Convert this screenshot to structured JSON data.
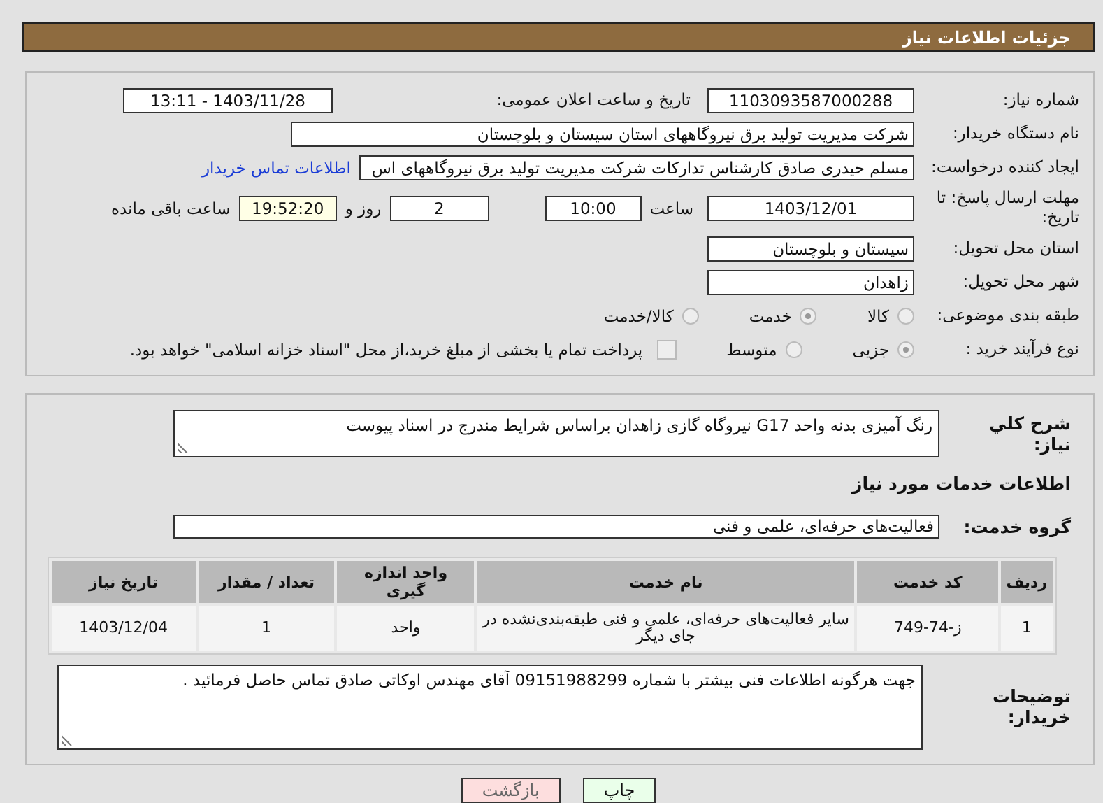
{
  "title": "جزئیات اطلاعات نیاز",
  "need_number": {
    "label": "شماره نیاز:",
    "value": "1103093587000288"
  },
  "announce": {
    "label": "تاریخ و ساعت اعلان عمومی:",
    "value": "1403/11/28 - 13:11"
  },
  "buyer": {
    "label": "نام دستگاه خریدار:",
    "value": "شرکت مدیریت تولید برق نیروگاههای استان سیستان و بلوچستان"
  },
  "requester": {
    "label": "ایجاد کننده درخواست:",
    "value": "مسلم حیدری صادق کارشناس تدارکات شرکت مدیریت تولید برق نیروگاههای اس",
    "link": "اطلاعات تماس خریدار"
  },
  "deadline": {
    "label": "مهلت ارسال پاسخ: تا تاریخ:",
    "date": "1403/12/01",
    "time_label": "ساعت",
    "time": "10:00",
    "days": "2",
    "days_label": "روز و",
    "remaining": "19:52:20",
    "remaining_label": "ساعت باقی مانده"
  },
  "province": {
    "label": "استان محل تحویل:",
    "value": "سیستان و بلوچستان"
  },
  "city": {
    "label": "شهر محل تحویل:",
    "value": "زاهدان"
  },
  "category": {
    "label": "طبقه بندی موضوعی:",
    "options": [
      {
        "label": "کالا",
        "selected": false
      },
      {
        "label": "خدمت",
        "selected": true
      },
      {
        "label": "کالا/خدمت",
        "selected": false
      }
    ]
  },
  "purchase_type": {
    "label": "نوع فرآیند خرید :",
    "options": [
      {
        "label": "جزیی",
        "selected": true
      },
      {
        "label": "متوسط",
        "selected": false
      }
    ],
    "payment": {
      "checked": false,
      "text": "پرداخت تمام یا بخشی از مبلغ خرید،از محل \"اسناد خزانه اسلامی\" خواهد بود."
    }
  },
  "summary": {
    "label": "شرح کلي نياز:",
    "value": "رنگ آمیزی بدنه واحد G17  نیروگاه گازی زاهدان براساس شرایط مندرج در اسناد پیوست"
  },
  "services_title": "اطلاعات خدمات مورد نیاز",
  "service_group": {
    "label": "گروه خدمت:",
    "value": "فعالیت‌های حرفه‌ای، علمی و فنی"
  },
  "table": {
    "columns": [
      "ردیف",
      "کد خدمت",
      "نام خدمت",
      "واحد اندازه گیری",
      "تعداد / مقدار",
      "تاریخ نیاز"
    ],
    "rows": [
      [
        "1",
        "ز-74-749",
        "سایر فعالیت‌های حرفه‌ای، علمی و فنی طبقه‌بندی‌نشده در جای دیگر",
        "واحد",
        "1",
        "1403/12/04"
      ]
    ]
  },
  "buyer_notes": {
    "label": "توضیحات خریدار:",
    "value": "جهت هرگونه اطلاعات فنی بیشتر با شماره 09151988299 آقای مهندس اوکاتی صادق تماس حاصل فرمائید ."
  },
  "buttons": [
    {
      "label": "چاپ",
      "kind": "print"
    },
    {
      "label": "بازگشت",
      "kind": "back"
    }
  ]
}
